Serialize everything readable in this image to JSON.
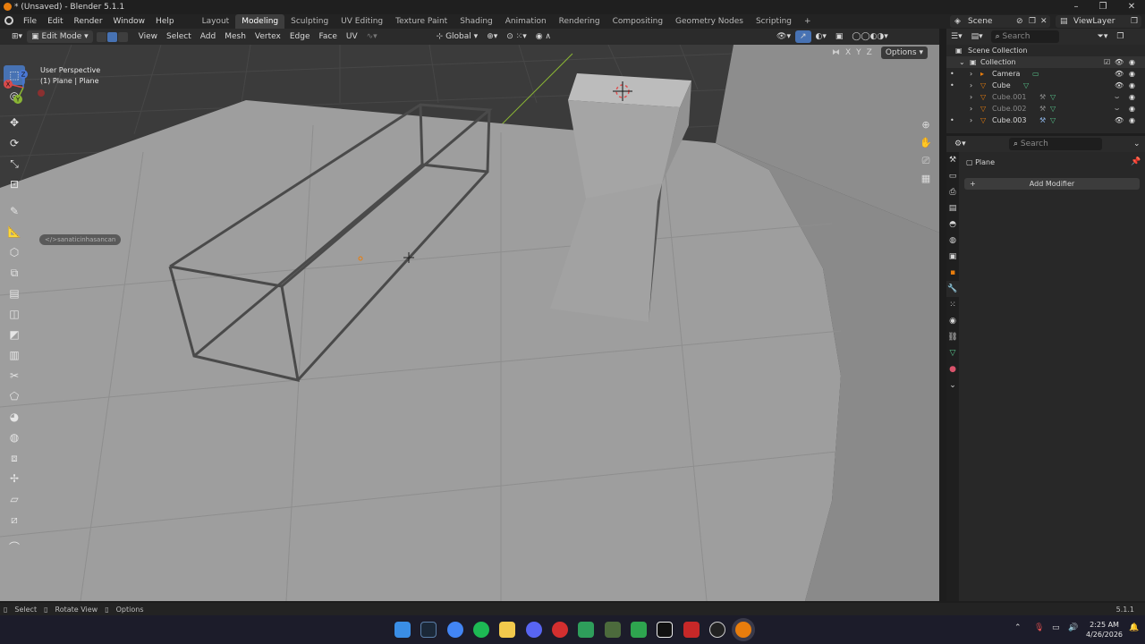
{
  "window": {
    "title": "* (Unsaved) - Blender 5.1.1",
    "minimize": "–",
    "maximize": "❐",
    "close": "✕"
  },
  "menu": [
    "File",
    "Edit",
    "Render",
    "Window",
    "Help"
  ],
  "workspaces": [
    "Layout",
    "Modeling",
    "Sculpting",
    "UV Editing",
    "Texture Paint",
    "Shading",
    "Animation",
    "Rendering",
    "Compositing",
    "Geometry Nodes",
    "Scripting"
  ],
  "workspace_add": "+",
  "active_workspace": "Modeling",
  "scene": "Scene",
  "view_layer": "ViewLayer",
  "viewport_header": {
    "mode": "Edit Mode",
    "menus": [
      "View",
      "Select",
      "Add",
      "Mesh",
      "Vertex",
      "Edge",
      "Face",
      "UV"
    ],
    "transform_orientation": "Global",
    "options": "Options",
    "axes": [
      "X",
      "Y",
      "Z"
    ]
  },
  "viewport_info": {
    "view": "User Perspective",
    "object": "(1) Plane | Plane"
  },
  "tooltip": "</>sanaticinhasancan",
  "gizmo": {
    "x": "X",
    "y": "Y",
    "z": "Z"
  },
  "outliner": {
    "search_placeholder": "Search",
    "root": "Scene Collection",
    "collection": "Collection",
    "items": [
      {
        "name": "Camera",
        "dim": false
      },
      {
        "name": "Cube",
        "dim": false
      },
      {
        "name": "Cube.001",
        "dim": true
      },
      {
        "name": "Cube.002",
        "dim": true
      },
      {
        "name": "Cube.003",
        "dim": false
      }
    ]
  },
  "properties": {
    "search_placeholder": "Search",
    "object": "Plane",
    "add_modifier": "Add Modifier"
  },
  "statusbar": {
    "select": "Select",
    "rotate": "Rotate View",
    "options": "Options",
    "version": "5.1.1"
  },
  "taskbar": {
    "time": "2:25 AM",
    "date": "4/26/2026"
  },
  "colors": {
    "accent": "#4772b3",
    "orange": "#e87d0d",
    "mesh_green": "#57c48b"
  }
}
